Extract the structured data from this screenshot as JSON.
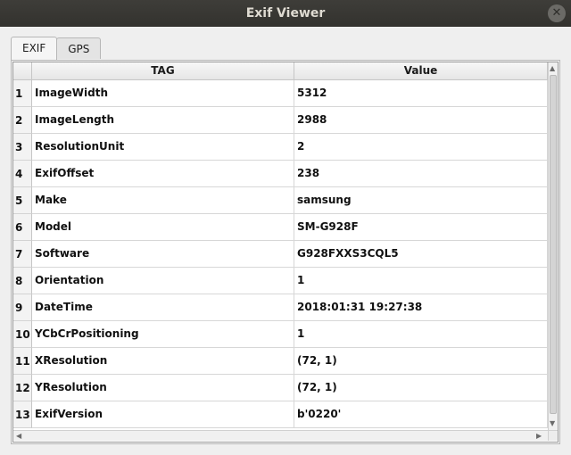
{
  "window": {
    "title": "Exif Viewer",
    "close_icon": "close-icon"
  },
  "tabs": [
    {
      "label": "EXIF",
      "active": true
    },
    {
      "label": "GPS",
      "active": false
    }
  ],
  "table": {
    "columns": [
      "TAG",
      "Value"
    ],
    "rows": [
      {
        "num": "1",
        "tag": "ImageWidth",
        "value": "5312"
      },
      {
        "num": "2",
        "tag": "ImageLength",
        "value": "2988"
      },
      {
        "num": "3",
        "tag": "ResolutionUnit",
        "value": "2"
      },
      {
        "num": "4",
        "tag": "ExifOffset",
        "value": "238"
      },
      {
        "num": "5",
        "tag": "Make",
        "value": "samsung"
      },
      {
        "num": "6",
        "tag": "Model",
        "value": "SM-G928F"
      },
      {
        "num": "7",
        "tag": "Software",
        "value": "G928FXXS3CQL5"
      },
      {
        "num": "8",
        "tag": "Orientation",
        "value": "1"
      },
      {
        "num": "9",
        "tag": "DateTime",
        "value": "2018:01:31 19:27:38"
      },
      {
        "num": "10",
        "tag": "YCbCrPositioning",
        "value": "1"
      },
      {
        "num": "11",
        "tag": "XResolution",
        "value": "(72, 1)"
      },
      {
        "num": "12",
        "tag": "YResolution",
        "value": "(72, 1)"
      },
      {
        "num": "13",
        "tag": "ExifVersion",
        "value": "b'0220'"
      }
    ]
  },
  "scroll_arrows": {
    "up": "▲",
    "down": "▼",
    "left": "◀",
    "right": "▶"
  }
}
